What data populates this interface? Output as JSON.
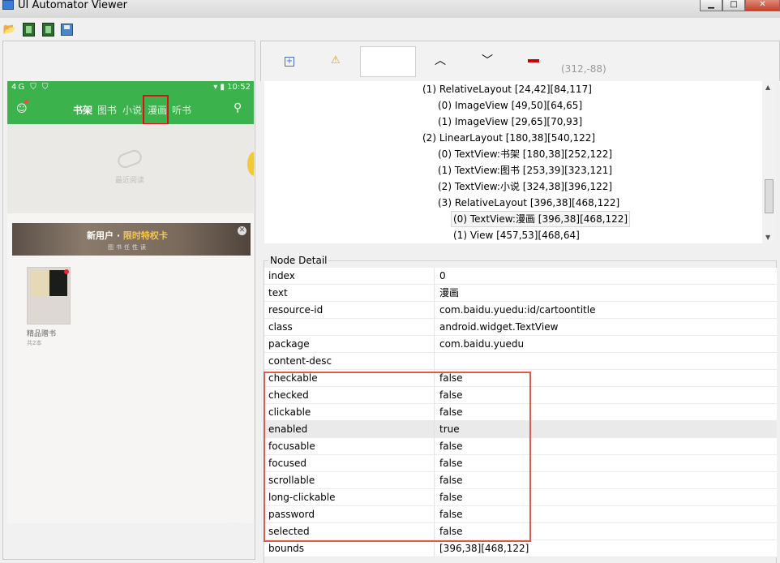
{
  "window": {
    "title": "UI Automator Viewer",
    "min_label": "▁",
    "max_label": "□",
    "close_label": "✕"
  },
  "toolbar": {
    "open_icon": "folder-open-icon",
    "screenshot_icon": "device-screenshot-icon",
    "screenshot_compressed_icon": "device-screenshot-compressed-icon",
    "save_icon": "save-icon"
  },
  "phone": {
    "status_left": "4G ⛉ ⛉",
    "status_right": "▾ ▮ 10:52",
    "user_icon": "☺",
    "tabs": [
      "书架",
      "图书",
      "小说",
      "漫画",
      "听书"
    ],
    "search_icon": "⚲",
    "recent_label": "最近阅读",
    "banner_main_prefix": "新用户 · ",
    "banner_main_highlight": "限时特权卡",
    "banner_sub": "图书任性读",
    "banner_close": "✕",
    "book_title": "精品赠书",
    "book_count": "共2本",
    "fab_label": "+"
  },
  "tree_toolbar": {
    "expand_label": "+",
    "warn_label": "⚠",
    "up_label": "︿",
    "down_label": "﹀",
    "coords": "(312,-88)"
  },
  "tree": [
    "(1) RelativeLayout [24,42][84,117]",
    "(0) ImageView [49,50][64,65]",
    "(1) ImageView [29,65][70,93]",
    "(2) LinearLayout [180,38][540,122]",
    "(0) TextView:书架 [180,38][252,122]",
    "(1) TextView:图书 [253,39][323,121]",
    "(2) TextView:小说 [324,38][396,122]",
    "(3) RelativeLayout [396,38][468,122]",
    "(0) TextView:漫画 [396,38][468,122]",
    "(1) View [457,53][468,64]"
  ],
  "scrollbar": {
    "up": "▲",
    "down": "▼"
  },
  "node_detail": {
    "title": "Node Detail",
    "rows": [
      {
        "key": "index",
        "value": "0"
      },
      {
        "key": "text",
        "value": "漫画"
      },
      {
        "key": "resource-id",
        "value": "com.baidu.yuedu:id/cartoontitle"
      },
      {
        "key": "class",
        "value": "android.widget.TextView"
      },
      {
        "key": "package",
        "value": "com.baidu.yuedu"
      },
      {
        "key": "content-desc",
        "value": ""
      },
      {
        "key": "checkable",
        "value": "false"
      },
      {
        "key": "checked",
        "value": "false"
      },
      {
        "key": "clickable",
        "value": "false"
      },
      {
        "key": "enabled",
        "value": "true"
      },
      {
        "key": "focusable",
        "value": "false"
      },
      {
        "key": "focused",
        "value": "false"
      },
      {
        "key": "scrollable",
        "value": "false"
      },
      {
        "key": "long-clickable",
        "value": "false"
      },
      {
        "key": "password",
        "value": "false"
      },
      {
        "key": "selected",
        "value": "false"
      },
      {
        "key": "bounds",
        "value": "[396,38][468,122]"
      }
    ]
  },
  "colors": {
    "app_green": "#3cb24c",
    "highlight_red": "#e01010"
  }
}
